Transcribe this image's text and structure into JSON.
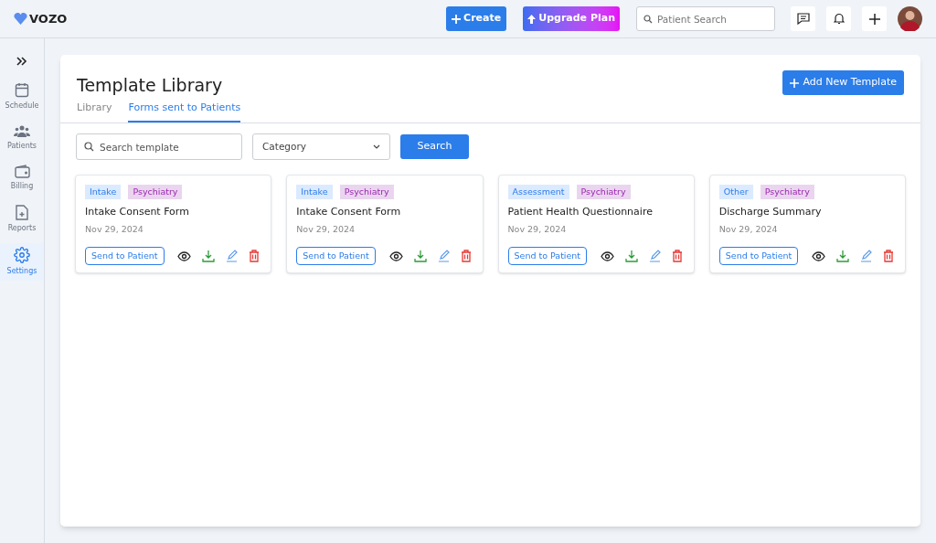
{
  "header": {
    "logo": "VOZO",
    "create_button": "Create",
    "upgrade_button": "Upgrade Plan",
    "search": {
      "placeholder": "Patient Search"
    }
  },
  "sidebar": {
    "items": [
      {
        "kind": "schedule",
        "label": "Schedule",
        "selected": false
      },
      {
        "kind": "patients",
        "label": "Patients",
        "selected": false
      },
      {
        "kind": "billing",
        "label": "Billing",
        "selected": false
      },
      {
        "kind": "reports",
        "label": "Reports",
        "selected": false
      },
      {
        "kind": "settings",
        "label": "Settings",
        "selected": true
      }
    ]
  },
  "page": {
    "title": "Template Library",
    "add_button": "Add New Template",
    "tabs": [
      {
        "label": "Library",
        "selected": false
      },
      {
        "label": "Forms sent to Patients",
        "selected": true
      }
    ],
    "search": {
      "placeholder": "Search template"
    },
    "category_select": "Category",
    "search_button": "Search"
  },
  "templates": [
    {
      "tags": [
        {
          "kind": "category",
          "label": "Intake"
        },
        {
          "kind": "specialty",
          "label": "Psychiatry"
        }
      ],
      "name": "Intake Consent Form",
      "date": "Nov 29, 2024",
      "action": "Send to Patient"
    },
    {
      "tags": [
        {
          "kind": "category",
          "label": "Intake"
        },
        {
          "kind": "specialty",
          "label": "Psychiatry"
        }
      ],
      "name": "Intake Consent Form",
      "date": "Nov 29, 2024",
      "action": "Send to Patient"
    },
    {
      "tags": [
        {
          "kind": "category",
          "label": "Assessment"
        },
        {
          "kind": "specialty",
          "label": "Psychiatry"
        }
      ],
      "name": "Patient Health Questionnaire",
      "date": "Nov 29, 2024",
      "action": "Send to Patient"
    },
    {
      "tags": [
        {
          "kind": "category",
          "label": "Other"
        },
        {
          "kind": "specialty",
          "label": "Psychiatry"
        }
      ],
      "name": "Discharge Summary",
      "date": "Nov 29, 2024",
      "action": "Send to Patient"
    }
  ]
}
